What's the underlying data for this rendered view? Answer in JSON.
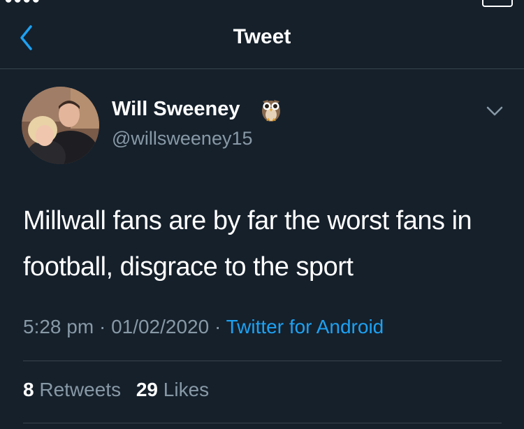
{
  "header": {
    "title": "Tweet"
  },
  "author": {
    "display_name": "Will Sweeney",
    "emoji": "🦉",
    "username": "@willsweeney15"
  },
  "tweet": {
    "text": "Millwall fans are by far the worst fans in football, disgrace to the sport"
  },
  "meta": {
    "time": "5:28 pm",
    "separator": "·",
    "date": "01/02/2020",
    "source": "Twitter for Android"
  },
  "stats": {
    "retweets_count": "8",
    "retweets_label": "Retweets",
    "likes_count": "29",
    "likes_label": "Likes"
  },
  "colors": {
    "background": "#15202b",
    "accent": "#1da1f2",
    "secondary_text": "#8899a6",
    "divider": "#38444d"
  }
}
